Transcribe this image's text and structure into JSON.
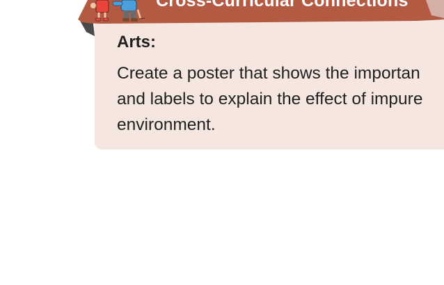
{
  "banner": {
    "title": "Cross-Curricular Connections",
    "color": "#b35a43",
    "icon": "children-illustration"
  },
  "card": {
    "background": "#f6e6e0",
    "heading": "Arts:",
    "lines": [
      "Create a poster that shows the importan",
      "and labels to explain the effect of impure",
      "environment."
    ]
  }
}
